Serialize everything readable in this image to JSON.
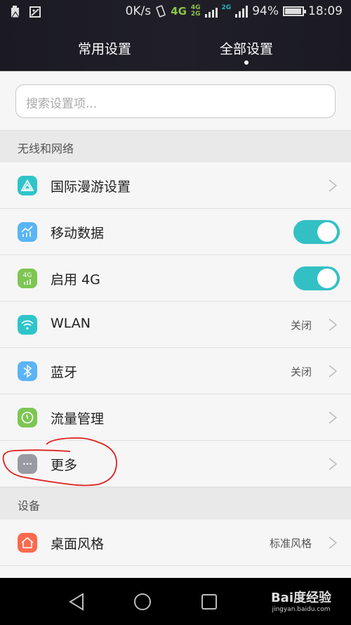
{
  "status_bar": {
    "net_speed": "0K/s",
    "network_primary": "4G",
    "network_secondary_top": "4G",
    "network_secondary_bottom": "2G",
    "network_tertiary": "2G",
    "battery": "94%",
    "time": "18:09"
  },
  "tabs": [
    {
      "label": "常用设置",
      "active": false
    },
    {
      "label": "全部设置",
      "active": true
    }
  ],
  "search": {
    "placeholder": "搜索设置项..."
  },
  "sections": [
    {
      "title": "无线和网络",
      "items": [
        {
          "label": "国际漫游设置",
          "icon": "roaming-icon",
          "color": "#2ec5c9",
          "control": "chevron"
        },
        {
          "label": "移动数据",
          "icon": "mobile-data-icon",
          "color": "#5ab4f5",
          "control": "toggle",
          "on": true
        },
        {
          "label": "启用 4G",
          "icon": "4g-icon",
          "color": "#7dc653",
          "control": "toggle",
          "on": true,
          "icon_text": "4G"
        },
        {
          "label": "WLAN",
          "icon": "wifi-icon",
          "color": "#2ec5c9",
          "control": "chevron",
          "value": "关闭"
        },
        {
          "label": "蓝牙",
          "icon": "bluetooth-icon",
          "color": "#5ab4f5",
          "control": "chevron",
          "value": "关闭"
        },
        {
          "label": "流量管理",
          "icon": "data-usage-icon",
          "color": "#7dc653",
          "control": "chevron"
        },
        {
          "label": "更多",
          "icon": "more-icon",
          "color": "#9a9aa2",
          "control": "chevron",
          "icon_text": "···"
        }
      ]
    },
    {
      "title": "设备",
      "items": [
        {
          "label": "桌面风格",
          "icon": "home-icon",
          "color": "#fb6a4f",
          "control": "chevron",
          "value": "标准风格"
        }
      ]
    }
  ],
  "watermark": {
    "brand": "Bai度经验",
    "url": "jingyan.baidu.com"
  },
  "colors": {
    "accent": "#33c0c4",
    "annotation": "#e02020"
  }
}
